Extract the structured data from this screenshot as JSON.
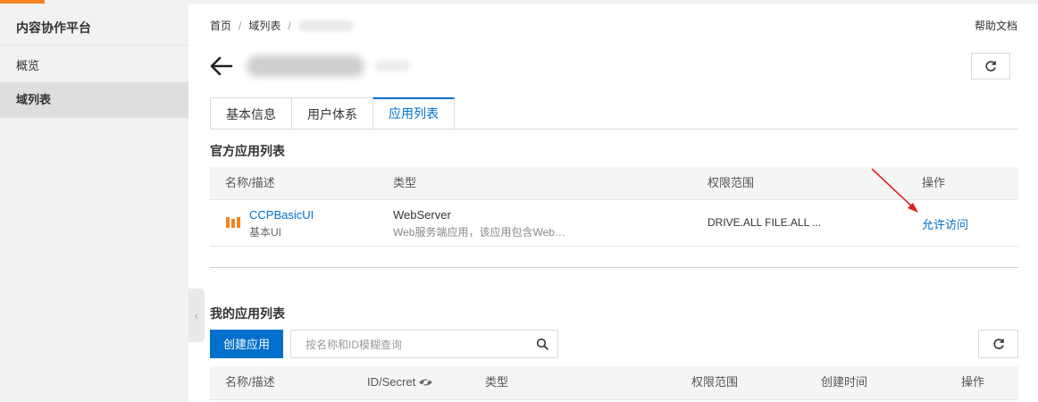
{
  "sidebar": {
    "title": "内容协作平台",
    "items": [
      {
        "label": "概览",
        "active": false
      },
      {
        "label": "域列表",
        "active": true
      }
    ]
  },
  "breadcrumb": {
    "items": [
      "首页",
      "域列表"
    ],
    "separator": "/"
  },
  "header": {
    "help_label": "帮助文档"
  },
  "tabs": [
    {
      "label": "基本信息",
      "active": false
    },
    {
      "label": "用户体系",
      "active": false
    },
    {
      "label": "应用列表",
      "active": true
    }
  ],
  "official_apps": {
    "title": "官方应用列表",
    "columns": [
      "名称/描述",
      "类型",
      "权限范围",
      "操作"
    ],
    "rows": [
      {
        "name": "CCPBasicUI",
        "desc": "基本UI",
        "type": "WebServer",
        "type_desc": "Web服务端应用，该应用包含Web…",
        "scope": "DRIVE.ALL  FILE.ALL  ...",
        "action": "允许访问"
      }
    ]
  },
  "my_apps": {
    "title": "我的应用列表",
    "create_label": "创建应用",
    "search_placeholder": "按名称和ID模糊查询",
    "columns": [
      "名称/描述",
      "ID/Secret",
      "类型",
      "权限范围",
      "创建时间",
      "操作"
    ]
  },
  "colors": {
    "accent": "#0070cc",
    "brand": "#f5821f",
    "annotation_arrow": "#e02020"
  },
  "icons": [
    "back-arrow-icon",
    "refresh-icon",
    "search-icon",
    "eye-hidden-icon",
    "app-bars-icon",
    "chevron-left-icon"
  ]
}
